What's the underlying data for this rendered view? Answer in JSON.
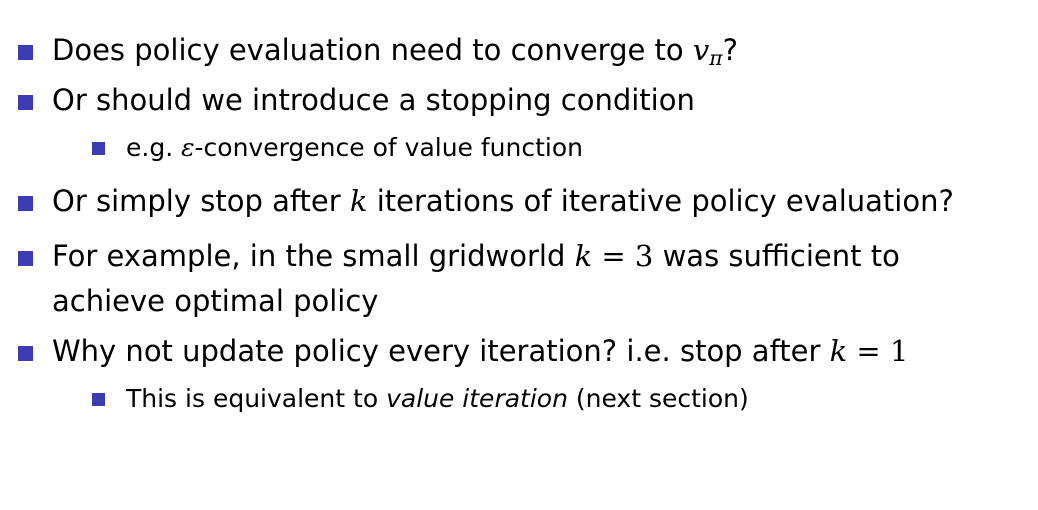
{
  "bullets": [
    {
      "pre": "Does policy evaluation need to converge to ",
      "math_v": "v",
      "math_sub": "π",
      "post": "?"
    },
    {
      "text": "Or should we introduce a stopping condition"
    },
    {
      "pre": "e.g. ",
      "math_eps": "ε",
      "post": "-convergence of value function"
    },
    {
      "pre": "Or simply stop after ",
      "math_k": "k",
      "post": " iterations of iterative policy evaluation?"
    },
    {
      "pre": "For example, in the small gridworld ",
      "math_k": "k",
      "math_eq": " = 3",
      "post": " was sufficient to",
      "line2": "achieve optimal policy"
    },
    {
      "pre": "Why not update policy every iteration? i.e. stop after ",
      "math_k": "k",
      "math_eq": " = 1"
    },
    {
      "pre": "This is equivalent to ",
      "em": "value iteration",
      "post": " (next section)"
    }
  ],
  "colors": {
    "bullet": "#3b3bb2",
    "text": "#000000",
    "background": "#ffffff"
  }
}
